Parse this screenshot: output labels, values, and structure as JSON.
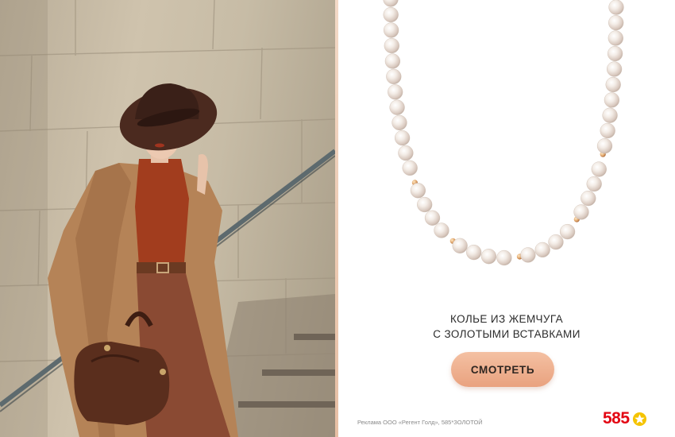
{
  "product": {
    "title_line1": "КОЛЬЕ ИЗ ЖЕМЧУГА",
    "title_line2": "С ЗОЛОТЫМИ ВСТАВКАМИ"
  },
  "cta": {
    "label": "СМОТРЕТЬ"
  },
  "footer": {
    "disclaimer": "Реклама ООО «Регент Голд», 585*ЗОЛОТОЙ",
    "logo_text": "585"
  },
  "colors": {
    "button": "#f0b192",
    "logo_red": "#e30613",
    "logo_star": "#f5c400"
  },
  "icons": {
    "logo_star": "star-icon"
  }
}
